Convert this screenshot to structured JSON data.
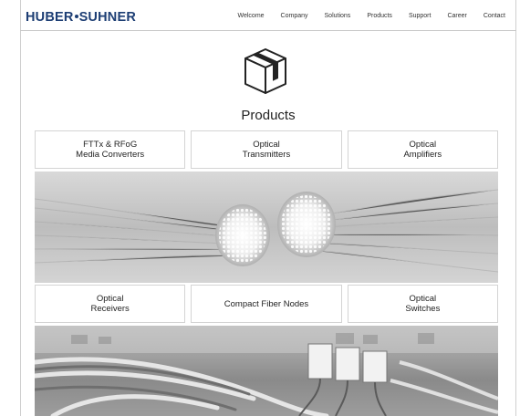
{
  "brand": {
    "logo_text_left": "HUBER",
    "logo_text_right": "SUHNER"
  },
  "nav": {
    "items": [
      "Welcome",
      "Company",
      "Solutions",
      "Products",
      "Support",
      "Career",
      "Contact"
    ]
  },
  "page": {
    "title": "Products",
    "icon": "box-icon"
  },
  "tiles_row1": [
    "FTTx & RFoG\nMedia Converters",
    "Optical\nTransmitters",
    "Optical\nAmplifiers"
  ],
  "tiles_row2": [
    "Optical\nReceivers",
    "Compact Fiber Nodes",
    "Optical\nSwitches"
  ],
  "images": {
    "banner_1": "fiber-optic-bundles-photo",
    "banner_2": "network-cables-photo"
  }
}
